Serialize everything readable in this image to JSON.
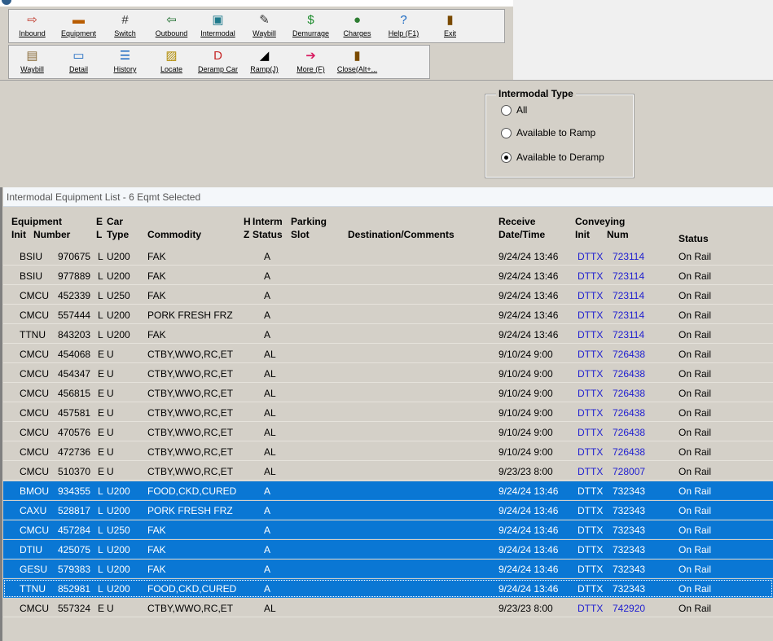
{
  "toolbar1": [
    {
      "label": "Inbound",
      "icon": "inbound-icon",
      "glyph": "⇨",
      "color": "#c0392b"
    },
    {
      "label": "Equipment",
      "icon": "equipment-icon",
      "glyph": "▬",
      "color": "#b85c00"
    },
    {
      "label": "Switch",
      "icon": "switch-icon",
      "glyph": "#",
      "color": "#333333"
    },
    {
      "label": "Outbound",
      "icon": "outbound-icon",
      "glyph": "⇦",
      "color": "#1a6b2a"
    },
    {
      "label": "Intermodal",
      "icon": "intermodal-icon",
      "glyph": "▣",
      "color": "#1f7a8c"
    },
    {
      "label": "Waybill",
      "icon": "waybill-icon",
      "glyph": "✎",
      "color": "#333333"
    },
    {
      "label": "Demurrage",
      "icon": "demurrage-icon",
      "glyph": "$",
      "color": "#1a8a2a"
    },
    {
      "label": "Charges",
      "icon": "charges-icon",
      "glyph": "●",
      "color": "#2e7d32"
    },
    {
      "label": "Help (F1)",
      "icon": "help-icon",
      "glyph": "?",
      "color": "#1565c0"
    },
    {
      "label": "Exit",
      "icon": "exit-icon",
      "glyph": "▮",
      "color": "#7a4a00"
    }
  ],
  "toolbar2": [
    {
      "label": "Waybill",
      "icon": "waybill-doc-icon",
      "glyph": "▤",
      "color": "#8a6d3b"
    },
    {
      "label": "Detail",
      "icon": "detail-icon",
      "glyph": "▭",
      "color": "#1565c0"
    },
    {
      "label": "History",
      "icon": "history-icon",
      "glyph": "☰",
      "color": "#1565c0"
    },
    {
      "label": "Locate",
      "icon": "locate-icon",
      "glyph": "▨",
      "color": "#b08a00"
    },
    {
      "label": "Deramp Car",
      "icon": "deramp-car-icon",
      "glyph": "D",
      "color": "#c62828"
    },
    {
      "label": "Ramp(J)",
      "icon": "ramp-icon",
      "glyph": "◢",
      "color": "#000000"
    },
    {
      "label": "More (F)",
      "icon": "more-icon",
      "glyph": "➔",
      "color": "#d81b60"
    },
    {
      "label": "Close(Alt+...",
      "icon": "close-icon",
      "glyph": "▮",
      "color": "#7a4a00"
    }
  ],
  "filter": {
    "title": "Intermodal Type",
    "options": [
      {
        "label": "All",
        "selected": false
      },
      {
        "label": "Available to Ramp",
        "selected": false
      },
      {
        "label": "Available to Deramp",
        "selected": true
      }
    ]
  },
  "list": {
    "title": "Intermodal Equipment List - 6 Eqmt Selected",
    "headers": {
      "equipment": "Equipment",
      "init": "Init",
      "number": "Number",
      "e": "E",
      "l": "L",
      "car": "Car",
      "type": "Type",
      "commodity": "Commodity",
      "h": "H",
      "z": "Z",
      "interm": "Interm",
      "status": "Status",
      "parking": "Parking",
      "slot": "Slot",
      "dest": "Destination/Comments",
      "receive": "Receive",
      "datetime": "Date/Time",
      "conveying": "Conveying",
      "cinit": "Init",
      "cnum": "Num",
      "rowstatus": "Status"
    },
    "rows": [
      {
        "init": "BSIU",
        "num": "970675",
        "el": "L",
        "type": "U200",
        "commodity": "FAK",
        "interm": "A",
        "recv": "9/24/24 13:46",
        "cinit": "DTTX",
        "cnum": "723114",
        "status": "On Rail",
        "selected": false
      },
      {
        "init": "BSIU",
        "num": "977889",
        "el": "L",
        "type": "U200",
        "commodity": "FAK",
        "interm": "A",
        "recv": "9/24/24 13:46",
        "cinit": "DTTX",
        "cnum": "723114",
        "status": "On Rail",
        "selected": false
      },
      {
        "init": "CMCU",
        "num": "452339",
        "el": "L",
        "type": "U250",
        "commodity": "FAK",
        "interm": "A",
        "recv": "9/24/24 13:46",
        "cinit": "DTTX",
        "cnum": "723114",
        "status": "On Rail",
        "selected": false
      },
      {
        "init": "CMCU",
        "num": "557444",
        "el": "L",
        "type": "U200",
        "commodity": "PORK FRESH FRZ",
        "interm": "A",
        "recv": "9/24/24 13:46",
        "cinit": "DTTX",
        "cnum": "723114",
        "status": "On Rail",
        "selected": false
      },
      {
        "init": "TTNU",
        "num": "843203",
        "el": "L",
        "type": "U200",
        "commodity": "FAK",
        "interm": "A",
        "recv": "9/24/24 13:46",
        "cinit": "DTTX",
        "cnum": "723114",
        "status": "On Rail",
        "selected": false
      },
      {
        "init": "CMCU",
        "num": "454068",
        "el": "E",
        "type": "U",
        "commodity": "CTBY,WWO,RC,ET",
        "interm": "AL",
        "recv": "9/10/24 9:00",
        "cinit": "DTTX",
        "cnum": "726438",
        "status": "On Rail",
        "selected": false
      },
      {
        "init": "CMCU",
        "num": "454347",
        "el": "E",
        "type": "U",
        "commodity": "CTBY,WWO,RC,ET",
        "interm": "AL",
        "recv": "9/10/24 9:00",
        "cinit": "DTTX",
        "cnum": "726438",
        "status": "On Rail",
        "selected": false
      },
      {
        "init": "CMCU",
        "num": "456815",
        "el": "E",
        "type": "U",
        "commodity": "CTBY,WWO,RC,ET",
        "interm": "AL",
        "recv": "9/10/24 9:00",
        "cinit": "DTTX",
        "cnum": "726438",
        "status": "On Rail",
        "selected": false
      },
      {
        "init": "CMCU",
        "num": "457581",
        "el": "E",
        "type": "U",
        "commodity": "CTBY,WWO,RC,ET",
        "interm": "AL",
        "recv": "9/10/24 9:00",
        "cinit": "DTTX",
        "cnum": "726438",
        "status": "On Rail",
        "selected": false
      },
      {
        "init": "CMCU",
        "num": "470576",
        "el": "E",
        "type": "U",
        "commodity": "CTBY,WWO,RC,ET",
        "interm": "AL",
        "recv": "9/10/24 9:00",
        "cinit": "DTTX",
        "cnum": "726438",
        "status": "On Rail",
        "selected": false
      },
      {
        "init": "CMCU",
        "num": "472736",
        "el": "E",
        "type": "U",
        "commodity": "CTBY,WWO,RC,ET",
        "interm": "AL",
        "recv": "9/10/24 9:00",
        "cinit": "DTTX",
        "cnum": "726438",
        "status": "On Rail",
        "selected": false
      },
      {
        "init": "CMCU",
        "num": "510370",
        "el": "E",
        "type": "U",
        "commodity": "CTBY,WWO,RC,ET",
        "interm": "AL",
        "recv": "9/23/23 8:00",
        "cinit": "DTTX",
        "cnum": "728007",
        "status": "On Rail",
        "selected": false
      },
      {
        "init": "BMOU",
        "num": "934355",
        "el": "L",
        "type": "U200",
        "commodity": "FOOD,CKD,CURED",
        "interm": "A",
        "recv": "9/24/24 13:46",
        "cinit": "DTTX",
        "cnum": "732343",
        "status": "On Rail",
        "selected": true
      },
      {
        "init": "CAXU",
        "num": "528817",
        "el": "L",
        "type": "U200",
        "commodity": "PORK FRESH FRZ",
        "interm": "A",
        "recv": "9/24/24 13:46",
        "cinit": "DTTX",
        "cnum": "732343",
        "status": "On Rail",
        "selected": true
      },
      {
        "init": "CMCU",
        "num": "457284",
        "el": "L",
        "type": "U250",
        "commodity": "FAK",
        "interm": "A",
        "recv": "9/24/24 13:46",
        "cinit": "DTTX",
        "cnum": "732343",
        "status": "On Rail",
        "selected": true
      },
      {
        "init": "DTIU",
        "num": "425075",
        "el": "L",
        "type": "U200",
        "commodity": "FAK",
        "interm": "A",
        "recv": "9/24/24 13:46",
        "cinit": "DTTX",
        "cnum": "732343",
        "status": "On Rail",
        "selected": true
      },
      {
        "init": "GESU",
        "num": "579383",
        "el": "L",
        "type": "U200",
        "commodity": "FAK",
        "interm": "A",
        "recv": "9/24/24 13:46",
        "cinit": "DTTX",
        "cnum": "732343",
        "status": "On Rail",
        "selected": true
      },
      {
        "init": "TTNU",
        "num": "852981",
        "el": "L",
        "type": "U200",
        "commodity": "FOOD,CKD,CURED",
        "interm": "A",
        "recv": "9/24/24 13:46",
        "cinit": "DTTX",
        "cnum": "732343",
        "status": "On Rail",
        "selected": true,
        "focus": true
      },
      {
        "init": "CMCU",
        "num": "557324",
        "el": "E",
        "type": "U",
        "commodity": "CTBY,WWO,RC,ET",
        "interm": "AL",
        "recv": "9/23/23 8:00",
        "cinit": "DTTX",
        "cnum": "742920",
        "status": "On Rail",
        "selected": false
      }
    ]
  }
}
